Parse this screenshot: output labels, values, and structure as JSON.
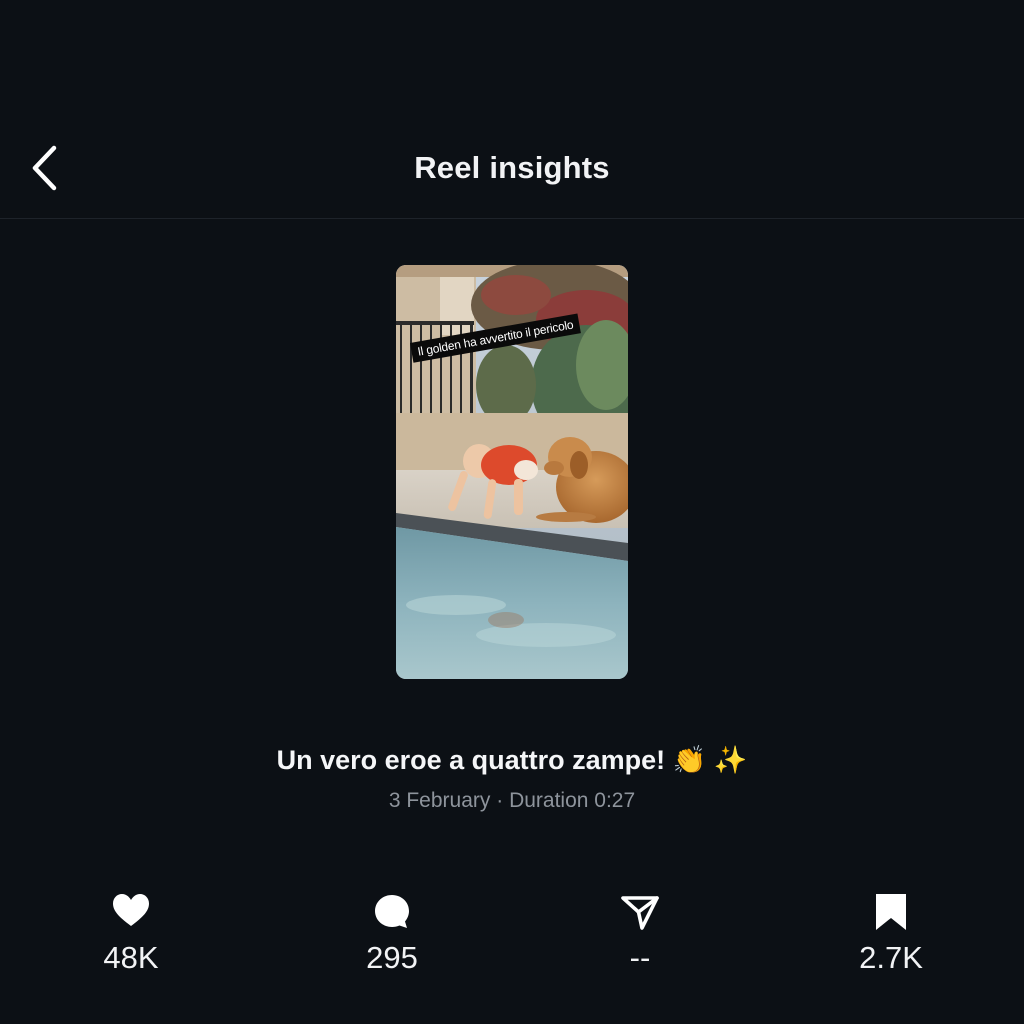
{
  "header": {
    "title": "Reel insights",
    "back_icon": "chevron-left-icon"
  },
  "reel": {
    "overlay_text": "Il golden ha avvertito il pericolo",
    "caption": "Un vero eroe a quattro zampe! 👏 ✨",
    "date": "3 February",
    "separator": "·",
    "duration_label": "Duration",
    "duration": "0:27"
  },
  "stats": [
    {
      "icon": "heart-icon",
      "value": "48K"
    },
    {
      "icon": "comment-icon",
      "value": "295"
    },
    {
      "icon": "share-icon",
      "value": "--"
    },
    {
      "icon": "bookmark-icon",
      "value": "2.7K"
    }
  ],
  "colors": {
    "background": "#0c1015",
    "text": "#f2f3f5",
    "muted_text": "#8e949c",
    "divider": "#1e232a"
  }
}
